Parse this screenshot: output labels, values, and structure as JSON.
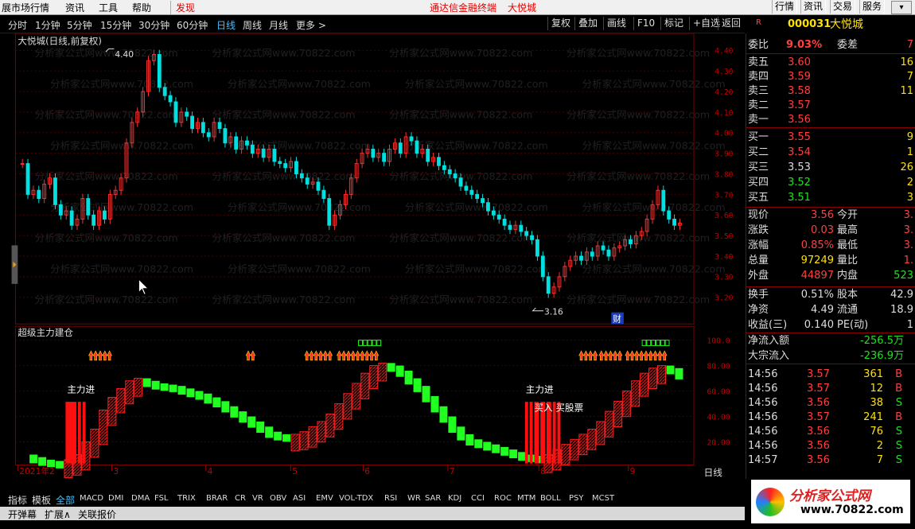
{
  "menu": {
    "items": [
      "展市场行情",
      "资讯",
      "工具",
      "帮助"
    ],
    "discover": "发现",
    "center": "通达信金融终端",
    "center2": "大悦城",
    "right": [
      "行情",
      "资讯",
      "交易",
      "服务"
    ]
  },
  "toolbar": {
    "periods": [
      "分时",
      "1分钟",
      "5分钟",
      "15分钟",
      "30分钟",
      "60分钟",
      "日线",
      "周线",
      "月线",
      "更多 >"
    ],
    "selected": "日线",
    "buttons": [
      "复权",
      "叠加",
      "画线",
      "F10",
      "标记",
      "+自选",
      "返回"
    ]
  },
  "chart": {
    "title": "大悦城(日线,前复权)",
    "high_label": "4.40",
    "low_label": "3.16",
    "cai_label": "财",
    "price_axis": [
      "4.40",
      "4.30",
      "4.20",
      "4.10",
      "4.00",
      "3.90",
      "3.80",
      "3.70",
      "3.60",
      "3.50",
      "3.40",
      "3.30",
      "3.20"
    ],
    "indicator_title": "超级主力建仓",
    "ind_axis": [
      "100.0",
      "80.00",
      "60.00",
      "40.00",
      "20.00"
    ],
    "label_zhulijin1": "主力进",
    "label_zhulijin2": "主力进",
    "label_buy": "买入 买股票",
    "watermark": "分析家公式网www.70822.com",
    "period_label": "日线",
    "date_axis": [
      "2021年2",
      "3",
      "4",
      "5",
      "6",
      "7",
      "8",
      "9"
    ]
  },
  "stock": {
    "flag": "R",
    "code": "000031",
    "name": "大悦城",
    "weibi_label": "委比",
    "weibi": "9.03%",
    "weicha_label": "委差",
    "weicha": "7",
    "sells": [
      {
        "label": "卖五",
        "price": "3.60",
        "vol": "16"
      },
      {
        "label": "卖四",
        "price": "3.59",
        "vol": "7"
      },
      {
        "label": "卖三",
        "price": "3.58",
        "vol": "11"
      },
      {
        "label": "卖二",
        "price": "3.57",
        "vol": ""
      },
      {
        "label": "卖一",
        "price": "3.56",
        "vol": ""
      }
    ],
    "buys": [
      {
        "label": "买一",
        "price": "3.55",
        "vol": "9"
      },
      {
        "label": "买二",
        "price": "3.54",
        "vol": "1"
      },
      {
        "label": "买三",
        "price": "3.53",
        "vol": "26"
      },
      {
        "label": "买四",
        "price": "3.52",
        "vol": "2"
      },
      {
        "label": "买五",
        "price": "3.51",
        "vol": "3"
      }
    ],
    "quote": [
      {
        "l": "现价",
        "v": "3.56",
        "l2": "今开",
        "v2": "3."
      },
      {
        "l": "涨跌",
        "v": "0.03",
        "l2": "最高",
        "v2": "3."
      },
      {
        "l": "涨幅",
        "v": "0.85%",
        "l2": "最低",
        "v2": "3."
      },
      {
        "l": "总量",
        "v": "97249",
        "l2": "量比",
        "v2": "1."
      },
      {
        "l": "外盘",
        "v": "44897",
        "l2": "内盘",
        "v2": "523"
      }
    ],
    "fund": [
      {
        "l": "换手",
        "v": "0.51%",
        "l2": "股本",
        "v2": "42.9"
      },
      {
        "l": "净资",
        "v": "4.49",
        "l2": "流通",
        "v2": "18.9"
      },
      {
        "l": "收益(三)",
        "v": "0.140",
        "l2": "PE(动)",
        "v2": "1"
      }
    ],
    "flow": [
      {
        "l": "净流入额",
        "v": "-256.5万"
      },
      {
        "l": "大宗流入",
        "v": "-236.9万"
      }
    ],
    "ticks": [
      {
        "t": "14:56",
        "p": "3.57",
        "v": "361",
        "s": "B"
      },
      {
        "t": "14:56",
        "p": "3.57",
        "v": "12",
        "s": "B"
      },
      {
        "t": "14:56",
        "p": "3.56",
        "v": "38",
        "s": "S"
      },
      {
        "t": "14:56",
        "p": "3.57",
        "v": "241",
        "s": "B"
      },
      {
        "t": "14:56",
        "p": "3.56",
        "v": "76",
        "s": "S"
      },
      {
        "t": "14:56",
        "p": "3.56",
        "v": "2",
        "s": "S"
      },
      {
        "t": "14:57",
        "p": "3.56",
        "v": "7",
        "s": "S"
      }
    ]
  },
  "bottom": {
    "tabs": [
      "指标",
      "模板",
      "全部",
      "MACD",
      "DMI",
      "DMA",
      "FSL",
      "TRIX",
      "BRAR",
      "CR",
      "VR",
      "OBV",
      "ASI",
      "EMV",
      "VOL-TDX",
      "RSI",
      "WR",
      "SAR",
      "KDJ",
      "CCI",
      "ROC",
      "MTM",
      "BOLL",
      "PSY",
      "MCST"
    ],
    "row2": [
      "开弹幕",
      "扩展∧",
      "关联报价"
    ],
    "logo": "分析家公式网",
    "logo_url": "www.70822.com"
  }
}
